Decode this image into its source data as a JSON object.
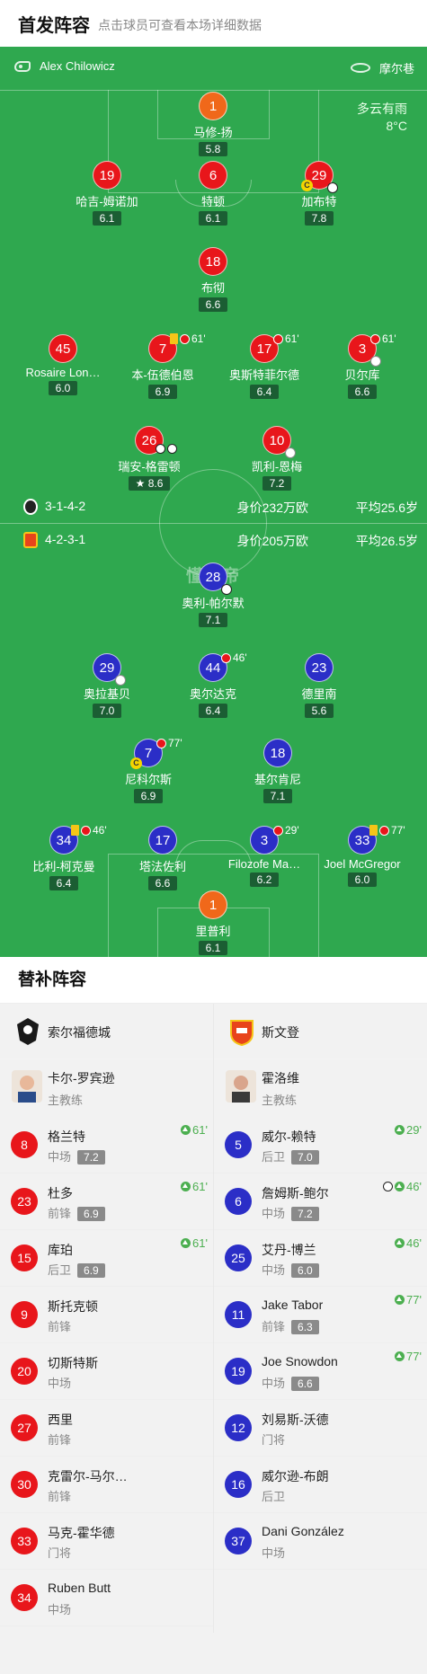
{
  "header": {
    "title": "首发阵容",
    "subtitle": "点击球员可查看本场详细数据"
  },
  "match": {
    "referee": "Alex Chilowicz",
    "venue": "摩尔巷",
    "weather": "多云有雨",
    "temperature": "8°C"
  },
  "home": {
    "formation": "3-1-4-2",
    "value": "身价232万欧",
    "avg_age": "平均25.6岁",
    "color": "#e8161b"
  },
  "away": {
    "formation": "4-2-3-1",
    "value": "身价205万欧",
    "avg_age": "平均26.5岁",
    "color": "#2b2ec7"
  },
  "watermark": "懂球帝",
  "home_players": [
    {
      "num": "1",
      "name": "马修-扬",
      "rating": "5.8"
    },
    {
      "num": "19",
      "name": "哈吉-姆诺加",
      "rating": "6.1"
    },
    {
      "num": "6",
      "name": "特顿",
      "rating": "6.1"
    },
    {
      "num": "29",
      "name": "加布特",
      "rating": "7.8"
    },
    {
      "num": "18",
      "name": "布彻",
      "rating": "6.6"
    },
    {
      "num": "45",
      "name": "Rosaire Lon…",
      "rating": "6.0"
    },
    {
      "num": "7",
      "name": "本-伍德伯恩",
      "rating": "6.9",
      "event": "61'"
    },
    {
      "num": "17",
      "name": "奥斯特菲尔德",
      "rating": "6.4",
      "event": "61'"
    },
    {
      "num": "3",
      "name": "贝尔库",
      "rating": "6.6",
      "event": "61'"
    },
    {
      "num": "26",
      "name": "瑞安-格雷顿",
      "rating": "8.6"
    },
    {
      "num": "10",
      "name": "凯利-恩梅",
      "rating": "7.2"
    }
  ],
  "away_players": [
    {
      "num": "28",
      "name": "奥利-帕尔默",
      "rating": "7.1"
    },
    {
      "num": "29",
      "name": "奥拉基贝",
      "rating": "7.0"
    },
    {
      "num": "44",
      "name": "奥尔达克",
      "rating": "6.4",
      "event": "46'"
    },
    {
      "num": "23",
      "name": "德里南",
      "rating": "5.6"
    },
    {
      "num": "7",
      "name": "尼科尔斯",
      "rating": "6.9",
      "event": "77'"
    },
    {
      "num": "18",
      "name": "基尔肯尼",
      "rating": "7.1"
    },
    {
      "num": "34",
      "name": "比利-柯克曼",
      "rating": "6.4",
      "event": "46'"
    },
    {
      "num": "17",
      "name": "塔法佐利",
      "rating": "6.6"
    },
    {
      "num": "3",
      "name": "Filozofe Ma…",
      "rating": "6.2",
      "event": "29'"
    },
    {
      "num": "33",
      "name": "Joel McGregor",
      "rating": "6.0",
      "event": "77'"
    },
    {
      "num": "1",
      "name": "里普利",
      "rating": "6.1"
    }
  ],
  "subs": {
    "title": "替补阵容",
    "home_team": "索尔福德城",
    "away_team": "斯文登",
    "home_coach": {
      "name": "卡尔-罗宾逊",
      "role": "主教练"
    },
    "away_coach": {
      "name": "霍洛维",
      "role": "主教练"
    },
    "home": [
      {
        "num": "8",
        "name": "格兰特",
        "pos": "中场",
        "rating": "7.2",
        "minute": "61'"
      },
      {
        "num": "23",
        "name": "杜多",
        "pos": "前锋",
        "rating": "6.9",
        "minute": "61'"
      },
      {
        "num": "15",
        "name": "库珀",
        "pos": "后卫",
        "rating": "6.9",
        "minute": "61'"
      },
      {
        "num": "9",
        "name": "斯托克顿",
        "pos": "前锋"
      },
      {
        "num": "20",
        "name": "切斯特斯",
        "pos": "中场"
      },
      {
        "num": "27",
        "name": "西里",
        "pos": "前锋"
      },
      {
        "num": "30",
        "name": "克雷尔-马尔…",
        "pos": "前锋"
      },
      {
        "num": "33",
        "name": "马克-霍华德",
        "pos": "门将"
      },
      {
        "num": "34",
        "name": "Ruben Butt",
        "pos": "中场"
      }
    ],
    "away": [
      {
        "num": "5",
        "name": "威尔-赖特",
        "pos": "后卫",
        "rating": "7.0",
        "minute": "29'"
      },
      {
        "num": "6",
        "name": "詹姆斯-鲍尔",
        "pos": "中场",
        "rating": "7.2",
        "minute": "46'"
      },
      {
        "num": "25",
        "name": "艾丹-博兰",
        "pos": "中场",
        "rating": "6.0",
        "minute": "46'"
      },
      {
        "num": "11",
        "name": "Jake Tabor",
        "pos": "前锋",
        "rating": "6.3",
        "minute": "77'"
      },
      {
        "num": "19",
        "name": "Joe Snowdon",
        "pos": "中场",
        "rating": "6.6",
        "minute": "77'"
      },
      {
        "num": "12",
        "name": "刘易斯-沃德",
        "pos": "门将"
      },
      {
        "num": "16",
        "name": "威尔逊-布朗",
        "pos": "后卫"
      },
      {
        "num": "37",
        "name": "Dani González",
        "pos": "中场"
      }
    ]
  }
}
